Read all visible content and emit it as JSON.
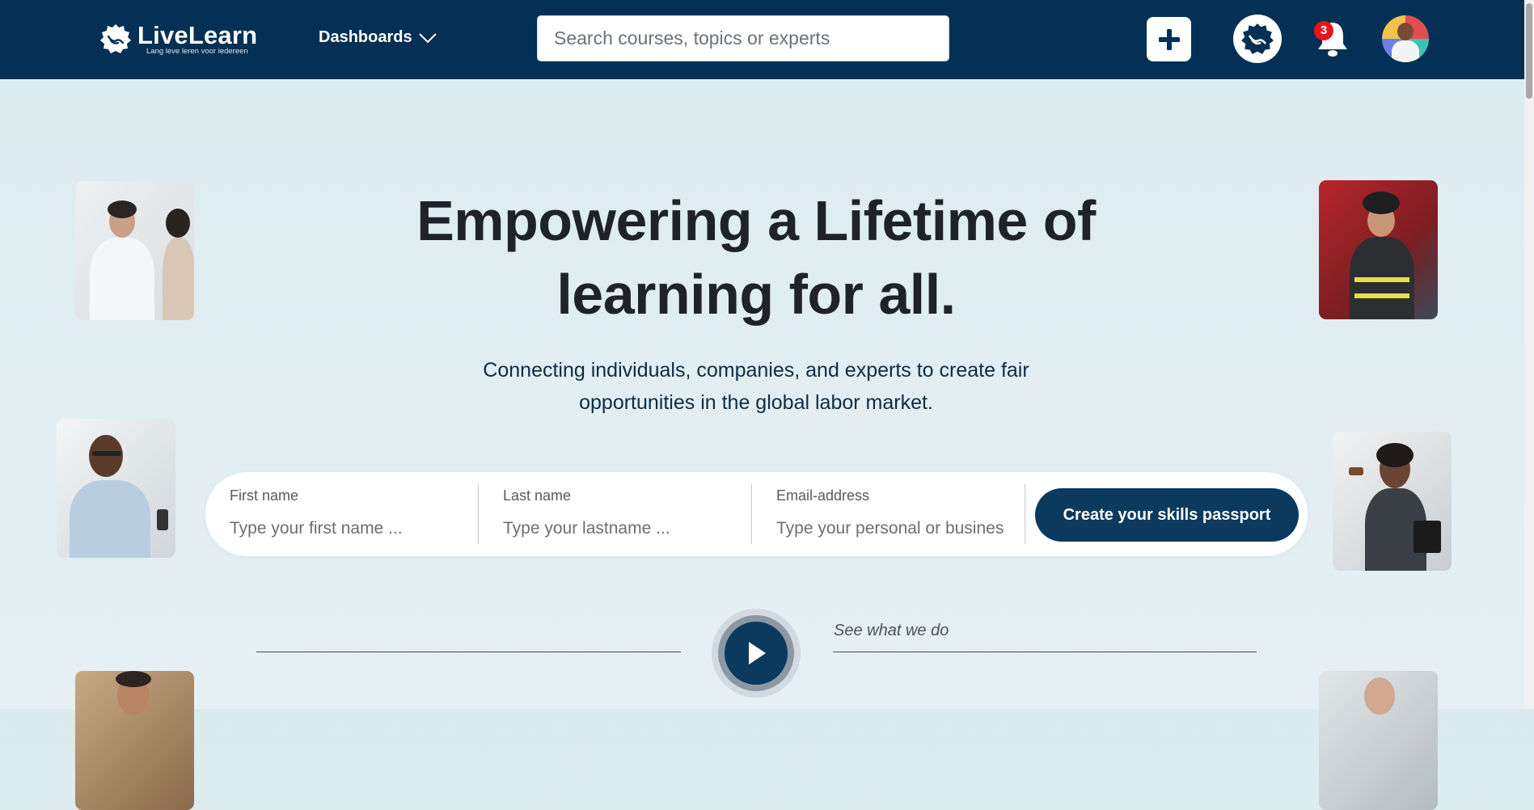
{
  "header": {
    "logo_title": "LiveLearn",
    "logo_tagline": "Lang leve leren voor iedereen",
    "dashboards_label": "Dashboards",
    "search_placeholder": "Search courses, topics or experts",
    "notification_count": "3",
    "brand_color": "#033054"
  },
  "hero": {
    "title_line1": "Empowering a Lifetime of",
    "title_line2": "learning for all.",
    "subtitle_line1": "Connecting individuals, companies, and experts to create fair",
    "subtitle_line2": "opportunities in the global labor market."
  },
  "signup": {
    "first_name_label": "First name",
    "first_name_placeholder": "Type your first name ...",
    "last_name_label": "Last name",
    "last_name_placeholder": "Type your lastname ...",
    "email_label": "Email-address",
    "email_placeholder": "Type your personal or business email",
    "cta_label": "Create your skills passport",
    "cta_color": "#0b3a5e"
  },
  "video": {
    "caption": "See what we do"
  },
  "icons": [
    "livelearn-logo-icon",
    "chevron-down-icon",
    "plus-icon",
    "livelearn-badge-icon",
    "bell-icon",
    "play-icon"
  ]
}
